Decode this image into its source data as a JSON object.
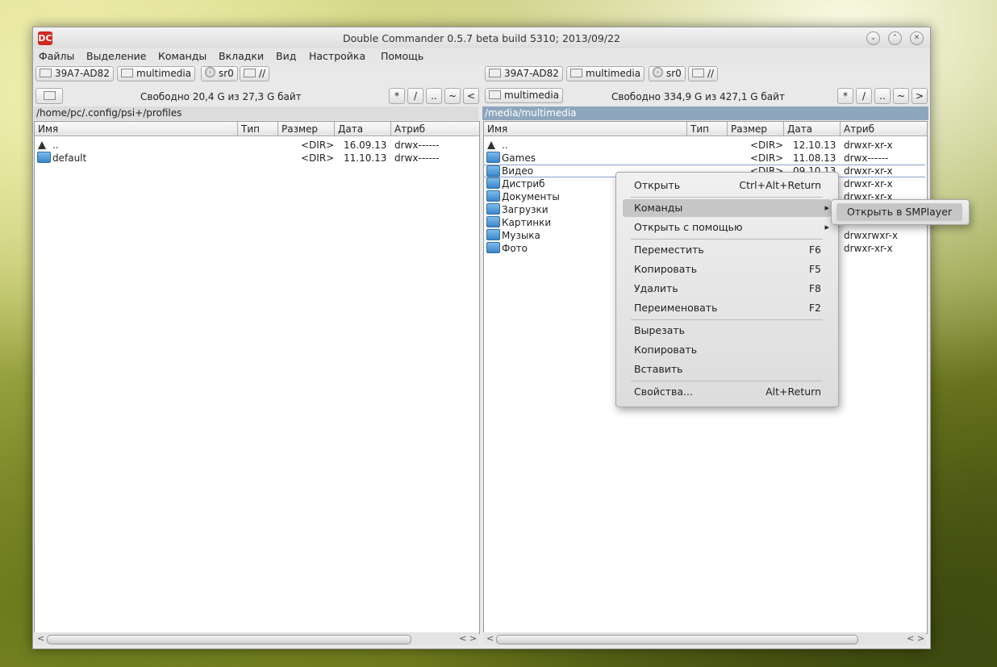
{
  "window": {
    "title": "Double Commander 0.5.7 beta build 5310; 2013/09/22",
    "logo": "DC"
  },
  "menu": [
    "Файлы",
    "Выделение",
    "Команды",
    "Вкладки",
    "Вид",
    "Настройка",
    "Помощь"
  ],
  "left": {
    "drives": [
      "39A7-AD82",
      "multimedia",
      "sr0",
      "//"
    ],
    "free": "Свободно 20,4 G из 27,3 G байт",
    "path": "/home/pc/.config/psi+/profiles",
    "path_buttons": [
      "*",
      "/",
      "..",
      "~",
      "<"
    ],
    "columns": [
      "Имя",
      "Тип",
      "Размер",
      "Дата",
      "Атриб"
    ],
    "rows": [
      {
        "name": "..",
        "size": "<DIR>",
        "date": "16.09.13",
        "attr": "drwx------"
      },
      {
        "name": "default",
        "size": "<DIR>",
        "date": "11.10.13",
        "attr": "drwx------"
      }
    ]
  },
  "right": {
    "drives": [
      "39A7-AD82",
      "multimedia",
      "sr0",
      "//"
    ],
    "drive_button": "multimedia",
    "free": "Свободно 334,9 G из 427,1 G байт",
    "path": "/media/multimedia",
    "path_buttons": [
      "*",
      "/",
      "..",
      "~",
      ">"
    ],
    "columns": [
      "Имя",
      "Тип",
      "Размер",
      "Дата",
      "Атриб"
    ],
    "rows": [
      {
        "name": "..",
        "size": "<DIR>",
        "date": "12.10.13",
        "attr": "drwxr-xr-x"
      },
      {
        "name": "Games",
        "size": "<DIR>",
        "date": "11.08.13",
        "attr": "drwx------"
      },
      {
        "name": "Видео",
        "size": "<DIR>",
        "date": "09.10.13",
        "attr": "drwxr-xr-x"
      },
      {
        "name": "Дистриб",
        "size": "",
        "date": "",
        "attr": "drwxr-xr-x"
      },
      {
        "name": "Документы",
        "size": "",
        "date": "",
        "attr": "drwxr-xr-x"
      },
      {
        "name": "Загрузки",
        "size": "",
        "date": "",
        "attr": ""
      },
      {
        "name": "Картинки",
        "size": "",
        "date": "",
        "attr": ""
      },
      {
        "name": "Музыка",
        "size": "",
        "date": "",
        "attr": "drwxrwxr-x"
      },
      {
        "name": "Фото",
        "size": "",
        "date": "",
        "attr": "drwxr-xr-x"
      }
    ]
  },
  "context_menu": {
    "open": {
      "label": "Открыть",
      "shortcut": "Ctrl+Alt+Return"
    },
    "commands": {
      "label": "Команды"
    },
    "open_with": {
      "label": "Открыть с помощью"
    },
    "move": {
      "label": "Переместить",
      "shortcut": "F6"
    },
    "copy": {
      "label": "Копировать",
      "shortcut": "F5"
    },
    "delete": {
      "label": "Удалить",
      "shortcut": "F8"
    },
    "rename": {
      "label": "Переименовать",
      "shortcut": "F2"
    },
    "cut": {
      "label": "Вырезать"
    },
    "copy2": {
      "label": "Копировать"
    },
    "paste": {
      "label": "Вставить"
    },
    "properties": {
      "label": "Свойства...",
      "shortcut": "Alt+Return"
    }
  },
  "submenu": {
    "item": "Открыть в SMPlayer"
  }
}
